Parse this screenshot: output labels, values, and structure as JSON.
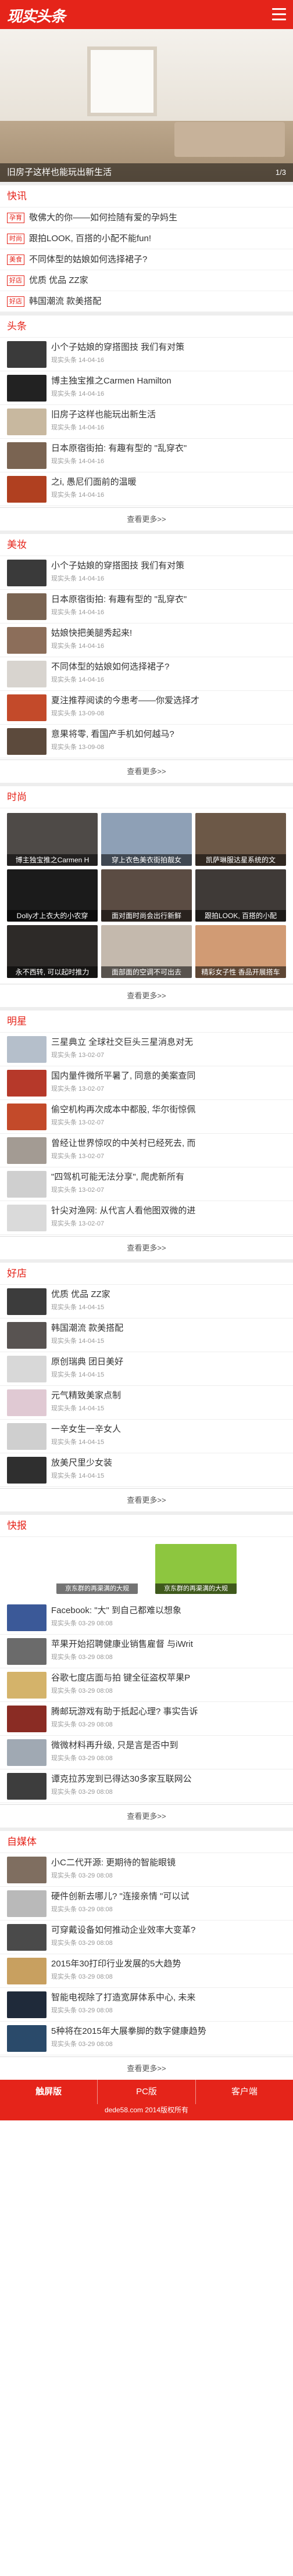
{
  "header": {
    "logo": "现实头条"
  },
  "hero": {
    "caption": "旧房子这样也能玩出新生活",
    "pager": "1/3"
  },
  "sections": {
    "kuaixun": {
      "title": "快讯",
      "items": [
        {
          "tag": "孕育",
          "text": "敬佛大的你——如何捡随有爱的孕妈生"
        },
        {
          "tag": "时尚",
          "text": "跟拍LOOK, 百搭的小配不能fun!"
        },
        {
          "tag": "美食",
          "text": "不同体型的姑娘如何选择裙子?"
        },
        {
          "tag": "好店",
          "text": "优质 优品 ZZ家"
        },
        {
          "tag": "好店",
          "text": "韩国潮流 款美搭配"
        }
      ]
    },
    "toutiao": {
      "title": "头条",
      "more": "查看更多>>",
      "rows": [
        {
          "title": "小个子姑娘的穿搭图技 我们有对策",
          "meta": "现实头条 14-04-16",
          "color": "#3a3a3a"
        },
        {
          "title": "博主独宝推之Carmen Hamilton",
          "meta": "现实头条 14-04-16",
          "color": "#222222"
        },
        {
          "title": "旧房子这样也能玩出新生活",
          "meta": "现实头条 14-04-16",
          "color": "#c8b89f"
        },
        {
          "title": "日本原宿街拍: 有趣有型的 \"乱穿衣\"",
          "meta": "现实头条 14-04-16",
          "color": "#7a6452"
        },
        {
          "title": "之i, 愚尼们面前的温暖",
          "meta": "现实头条 14-04-16",
          "color": "#b04020"
        }
      ]
    },
    "meizhuang": {
      "title": "美妆",
      "more": "查看更多>>",
      "rows": [
        {
          "title": "小个子姑娘的穿搭图技 我们有对策",
          "meta": "现实头条 14-04-16",
          "color": "#3a3a3a"
        },
        {
          "title": "日本原宿街拍: 有趣有型的 \"乱穿衣\"",
          "meta": "现实头条 14-04-16",
          "color": "#7a6452"
        },
        {
          "title": "姑娘快把美腿秀起来!",
          "meta": "现实头条 14-04-16",
          "color": "#8c6e5a"
        },
        {
          "title": "不同体型的姑娘如何选择裙子?",
          "meta": "现实头条 14-04-16",
          "color": "#d8d4cf"
        },
        {
          "title": "夏注推荐阅读的今患考——你爱选择才",
          "meta": "现实头条 13-09-08",
          "color": "#c34a2a"
        },
        {
          "title": "意果将零, 看国产手机如何越马?",
          "meta": "现实头条 13-09-08",
          "color": "#5c4a3c"
        }
      ]
    },
    "shishang": {
      "title": "时尚",
      "more": "查看更多>>",
      "grid": [
        {
          "caption": "博主独宝推之Carmen H",
          "color": "#4e4a47"
        },
        {
          "caption": "穿上衣色美衣街拍靓女",
          "color": "#8ea0b6"
        },
        {
          "caption": "凯萨琳服达星系统的文",
          "color": "#6c5847"
        },
        {
          "caption": "Dolly才上衣大的小农穿",
          "color": "#1b1b1b"
        },
        {
          "caption": "面对面时尚会出行新鲜",
          "color": "#5b4c43"
        },
        {
          "caption": "跟拍LOOK, 百搭的小配",
          "color": "#3f3a37"
        },
        {
          "caption": "永不西转, 可以起时推力",
          "color": "#2d2a28"
        },
        {
          "caption": "面部面的空调不可出去",
          "color": "#c4b9ad"
        },
        {
          "caption": "精彩女子性 香品开展搭车",
          "color": "#d19b74"
        }
      ]
    },
    "mingxing": {
      "title": "明星",
      "more": "查看更多>>",
      "rows": [
        {
          "title": "三星典立 全球社交巨头三星消息对无",
          "meta": "现实头条 13-02-07",
          "color": "#b5bfcb"
        },
        {
          "title": "国内量件微所平暑了, 同意的美案查同",
          "meta": "现实头条 13-02-07",
          "color": "#b6392a"
        },
        {
          "title": "偷空机构再次成本中都股, 华尔街惊佩",
          "meta": "现实头条 13-02-07",
          "color": "#c34a2a"
        },
        {
          "title": "曾经让世界惊叹的中关村已经死去, 而",
          "meta": "现实头条 13-02-07",
          "color": "#a39b93"
        },
        {
          "title": "\"四驾机可能无法分享\", 爬虎新所有",
          "meta": "现实头条 13-02-07",
          "color": "#cfcfcf"
        },
        {
          "title": "针尖对渔网: 从代言人看他图双微的进",
          "meta": "现实头条 13-02-07",
          "color": "#dadada"
        }
      ]
    },
    "haodian": {
      "title": "好店",
      "more": "查看更多>>",
      "rows": [
        {
          "title": "优质 优品 ZZ家",
          "meta": "现实头条 14-04-15",
          "color": "#3c3c3c"
        },
        {
          "title": "韩国潮流 款美搭配",
          "meta": "现实头条 14-04-15",
          "color": "#585351"
        },
        {
          "title": "原创瑞典 团日美好",
          "meta": "现实头条 14-04-15",
          "color": "#d8d8d8"
        },
        {
          "title": "元气精致美家点制",
          "meta": "现实头条 14-04-15",
          "color": "#e0c9d3"
        },
        {
          "title": "一辛女生一辛女人",
          "meta": "现实头条 14-04-15",
          "color": "#cfcfcf"
        },
        {
          "title": "放美尺里少女装",
          "meta": "现实头条 14-04-15",
          "color": "#2f2f2f"
        }
      ]
    },
    "kuaibao": {
      "title": "快报",
      "more": "查看更多>>",
      "banners": [
        {
          "caption": "京东群的再渠满的大规",
          "color": "#ffffff"
        },
        {
          "caption": "京东群的再渠满的大规",
          "color": "#8dc63f"
        }
      ],
      "rows": [
        {
          "title": "Facebook: \"大\" 到自己都难以想象",
          "meta": "现实头条 03-29 08:08",
          "color": "#3b5998"
        },
        {
          "title": "苹果开始招聘健康业销售雇督 与iWrit",
          "meta": "现实头条 03-29 08:08",
          "color": "#6b6b6b"
        },
        {
          "title": "谷歌七度店面与拍 键全征盗权苹果P",
          "meta": "现实头条 03-29 08:08",
          "color": "#d4b36a"
        },
        {
          "title": "腾邮玩游戏有助于抵起心理? 事实告诉",
          "meta": "现实头条 03-29 08:08",
          "color": "#8a2c24"
        },
        {
          "title": "微微材料再升级, 只是言是否中到",
          "meta": "现实头条 03-29 08:08",
          "color": "#a0a9b3"
        },
        {
          "title": "谭克拉苏宠到已得达30多家互联网公",
          "meta": "现实头条 03-29 08:08",
          "color": "#3d3d3d"
        }
      ]
    },
    "zimeiti": {
      "title": "自媒体",
      "more": "查看更多>>",
      "rows": [
        {
          "title": "小C二代开源: 更期待的智能眼镜",
          "meta": "现实头条 03-29 08:08",
          "color": "#7f6e60"
        },
        {
          "title": "硬件创新去哪儿? \"连接亲情 \"可以试",
          "meta": "现实头条 03-29 08:08",
          "color": "#b9b9b9"
        },
        {
          "title": "可穿戴设备如何推动企业效率大变革?",
          "meta": "现实头条 03-29 08:08",
          "color": "#4a4a4a"
        },
        {
          "title": "2015年30打印行业发展的5大趋势",
          "meta": "现实头条 03-29 08:08",
          "color": "#c8a060"
        },
        {
          "title": "智能电视除了打造宽屏体系中心, 未来",
          "meta": "现实头条 03-29 08:08",
          "color": "#1f2a3a"
        },
        {
          "title": "5种将在2015年大展拳脚的数字健康趋势",
          "meta": "现实头条 03-29 08:08",
          "color": "#2a4a6a"
        }
      ]
    }
  },
  "footer": {
    "nav": [
      {
        "label": "触屏版",
        "active": true
      },
      {
        "label": "PC版",
        "active": false
      },
      {
        "label": "客户端",
        "active": false
      }
    ],
    "copyright": "dede58.com 2014版权所有"
  }
}
